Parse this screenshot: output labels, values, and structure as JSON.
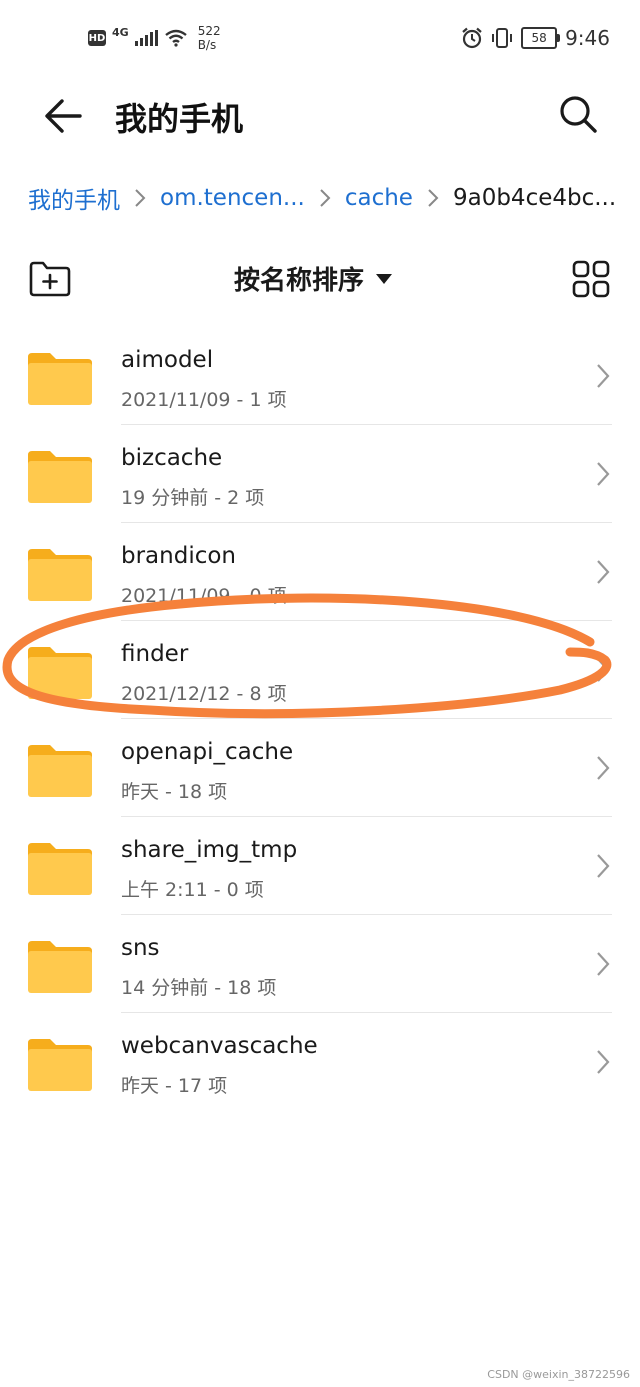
{
  "status_bar": {
    "hd": "HD",
    "network": "4G",
    "speed_top": "522",
    "speed_bottom": "B/s",
    "battery": "58",
    "time": "9:46"
  },
  "header": {
    "title": "我的手机",
    "back_icon": "arrow-left-icon",
    "search_icon": "search-icon"
  },
  "breadcrumb": [
    {
      "label": "我的手机"
    },
    {
      "label": "om.tencen..."
    },
    {
      "label": "cache"
    },
    {
      "label": "9a0b4ce4bc..."
    }
  ],
  "toolbar": {
    "sort_label": "按名称排序",
    "new_folder_icon": "new-folder-icon",
    "grid_icon": "grid-view-icon"
  },
  "folders": [
    {
      "name": "aimodel",
      "meta": "2021/11/09 - 1 项"
    },
    {
      "name": "bizcache",
      "meta": "19 分钟前 - 2 项"
    },
    {
      "name": "brandicon",
      "meta": "2021/11/09 - 0 项"
    },
    {
      "name": "finder",
      "meta": "2021/12/12 - 8 项"
    },
    {
      "name": "openapi_cache",
      "meta": "昨天 - 18 项"
    },
    {
      "name": "share_img_tmp",
      "meta": "上午 2:11  - 0 项"
    },
    {
      "name": "sns",
      "meta": "14 分钟前 - 18 项"
    },
    {
      "name": "webcanvascache",
      "meta": "昨天 - 17 项"
    }
  ],
  "colors": {
    "accent": "#1e6fd0",
    "folder": "#ffc94d",
    "folder_tab": "#f6ad1c",
    "annotation": "#f5813b"
  },
  "watermark": "CSDN @weixin_38722596"
}
